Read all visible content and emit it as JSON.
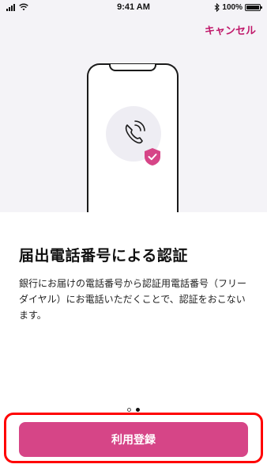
{
  "status_bar": {
    "time": "9:41 AM",
    "battery": "100%",
    "battery_level": 1.0
  },
  "header": {
    "cancel_label": "キャンセル"
  },
  "onboarding": {
    "title": "届出電話番号による認証",
    "description": "銀行にお届けの電話番号から認証用電話番号（フリーダイヤル）にお電話いただくことで、認証をおこないます。",
    "page_count": 2,
    "current_page": 2
  },
  "actions": {
    "register_label": "利用登録"
  },
  "colors": {
    "accent": "#c0186a",
    "button": "#d64587",
    "hero_bg": "#f4f3f7",
    "highlight": "#ff0000"
  },
  "icons": {
    "signal": "signal-icon",
    "wifi": "wifi-icon",
    "bluetooth": "bluetooth-icon",
    "battery": "battery-icon",
    "phone_call": "phone-call-icon",
    "shield_check": "shield-check-icon"
  }
}
